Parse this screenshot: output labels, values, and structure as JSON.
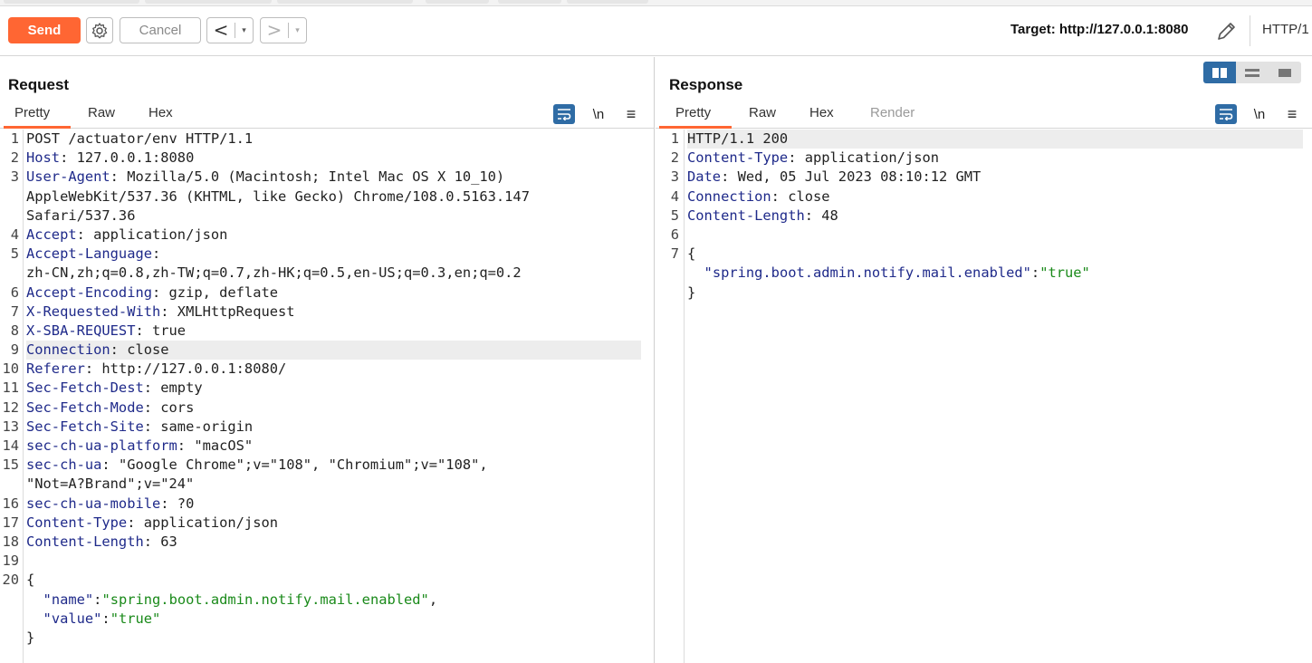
{
  "toolbar": {
    "send_label": "Send",
    "cancel_label": "Cancel",
    "back_arrow": "<",
    "forward_arrow": ">",
    "dropdown_glyph": "▾",
    "target": "Target: http://127.0.0.1:8080",
    "http_version": "HTTP/1"
  },
  "request": {
    "title": "Request",
    "tabs": [
      "Pretty",
      "Raw",
      "Hex"
    ],
    "active_tab": "Pretty",
    "newline_label": "\\n",
    "menu_glyph": "≡",
    "highlighted_line": 9,
    "lines": [
      {
        "n": "1",
        "parts": [
          [
            "t",
            "POST /actuator/env HTTP/1.1"
          ]
        ]
      },
      {
        "n": "2",
        "parts": [
          [
            "k",
            "Host"
          ],
          [
            "t",
            ": 127.0.0.1:8080"
          ]
        ]
      },
      {
        "n": "3",
        "parts": [
          [
            "k",
            "User-Agent"
          ],
          [
            "t",
            ": Mozilla/5.0 (Macintosh; Intel Mac OS X 10_10)"
          ]
        ]
      },
      {
        "n": "",
        "parts": [
          [
            "t",
            "AppleWebKit/537.36 (KHTML, like Gecko) Chrome/108.0.5163.147"
          ]
        ]
      },
      {
        "n": "",
        "parts": [
          [
            "t",
            "Safari/537.36"
          ]
        ]
      },
      {
        "n": "4",
        "parts": [
          [
            "k",
            "Accept"
          ],
          [
            "t",
            ": application/json"
          ]
        ]
      },
      {
        "n": "5",
        "parts": [
          [
            "k",
            "Accept-Language"
          ],
          [
            "t",
            ":"
          ]
        ]
      },
      {
        "n": "",
        "parts": [
          [
            "t",
            "zh-CN,zh;q=0.8,zh-TW;q=0.7,zh-HK;q=0.5,en-US;q=0.3,en;q=0.2"
          ]
        ]
      },
      {
        "n": "6",
        "parts": [
          [
            "k",
            "Accept-Encoding"
          ],
          [
            "t",
            ": gzip, deflate"
          ]
        ]
      },
      {
        "n": "7",
        "parts": [
          [
            "k",
            "X-Requested-With"
          ],
          [
            "t",
            ": XMLHttpRequest"
          ]
        ]
      },
      {
        "n": "8",
        "parts": [
          [
            "k",
            "X-SBA-REQUEST"
          ],
          [
            "t",
            ": true"
          ]
        ]
      },
      {
        "n": "9",
        "parts": [
          [
            "k",
            "Connection"
          ],
          [
            "t",
            ": close"
          ]
        ]
      },
      {
        "n": "10",
        "parts": [
          [
            "k",
            "Referer"
          ],
          [
            "t",
            ": http://127.0.0.1:8080/"
          ]
        ]
      },
      {
        "n": "11",
        "parts": [
          [
            "k",
            "Sec-Fetch-Dest"
          ],
          [
            "t",
            ": empty"
          ]
        ]
      },
      {
        "n": "12",
        "parts": [
          [
            "k",
            "Sec-Fetch-Mode"
          ],
          [
            "t",
            ": cors"
          ]
        ]
      },
      {
        "n": "13",
        "parts": [
          [
            "k",
            "Sec-Fetch-Site"
          ],
          [
            "t",
            ": same-origin"
          ]
        ]
      },
      {
        "n": "14",
        "parts": [
          [
            "k",
            "sec-ch-ua-platform"
          ],
          [
            "t",
            ": \"macOS\""
          ]
        ]
      },
      {
        "n": "15",
        "parts": [
          [
            "k",
            "sec-ch-ua"
          ],
          [
            "t",
            ": \"Google Chrome\";v=\"108\", \"Chromium\";v=\"108\","
          ]
        ]
      },
      {
        "n": "",
        "parts": [
          [
            "t",
            "\"Not=A?Brand\";v=\"24\""
          ]
        ]
      },
      {
        "n": "16",
        "parts": [
          [
            "k",
            "sec-ch-ua-mobile"
          ],
          [
            "t",
            ": ?0"
          ]
        ]
      },
      {
        "n": "17",
        "parts": [
          [
            "k",
            "Content-Type"
          ],
          [
            "t",
            ": application/json"
          ]
        ]
      },
      {
        "n": "18",
        "parts": [
          [
            "k",
            "Content-Length"
          ],
          [
            "t",
            ": 63"
          ]
        ]
      },
      {
        "n": "19",
        "parts": []
      },
      {
        "n": "20",
        "parts": [
          [
            "t",
            "{"
          ]
        ]
      },
      {
        "n": "",
        "parts": [
          [
            "t",
            "  "
          ],
          [
            "k",
            "\"name\""
          ],
          [
            "t",
            ":"
          ],
          [
            "s",
            "\"spring.boot.admin.notify.mail.enabled\""
          ],
          [
            "t",
            ","
          ]
        ]
      },
      {
        "n": "",
        "parts": [
          [
            "t",
            "  "
          ],
          [
            "k",
            "\"value\""
          ],
          [
            "t",
            ":"
          ],
          [
            "s",
            "\"true\""
          ]
        ]
      },
      {
        "n": "",
        "parts": [
          [
            "t",
            "}"
          ]
        ]
      }
    ]
  },
  "response": {
    "title": "Response",
    "tabs": [
      "Pretty",
      "Raw",
      "Hex",
      "Render"
    ],
    "active_tab": "Pretty",
    "newline_label": "\\n",
    "menu_glyph": "≡",
    "highlighted_line": 1,
    "lines": [
      {
        "n": "1",
        "parts": [
          [
            "t",
            "HTTP/1.1 200"
          ]
        ]
      },
      {
        "n": "2",
        "parts": [
          [
            "k",
            "Content-Type"
          ],
          [
            "t",
            ": application/json"
          ]
        ]
      },
      {
        "n": "3",
        "parts": [
          [
            "k",
            "Date"
          ],
          [
            "t",
            ": Wed, 05 Jul 2023 08:10:12 GMT"
          ]
        ]
      },
      {
        "n": "4",
        "parts": [
          [
            "k",
            "Connection"
          ],
          [
            "t",
            ": close"
          ]
        ]
      },
      {
        "n": "5",
        "parts": [
          [
            "k",
            "Content-Length"
          ],
          [
            "t",
            ": 48"
          ]
        ]
      },
      {
        "n": "6",
        "parts": []
      },
      {
        "n": "7",
        "parts": [
          [
            "t",
            "{"
          ]
        ]
      },
      {
        "n": "",
        "parts": [
          [
            "t",
            "  "
          ],
          [
            "k",
            "\"spring.boot.admin.notify.mail.enabled\""
          ],
          [
            "t",
            ":"
          ],
          [
            "s",
            "\"true\""
          ]
        ]
      },
      {
        "n": "",
        "parts": [
          [
            "t",
            "}"
          ]
        ]
      }
    ]
  },
  "colors": {
    "accent": "#ff6633",
    "header_key": "#1f2a8a",
    "string_value": "#1a8a1a",
    "wrap_button": "#2f6ca5"
  }
}
